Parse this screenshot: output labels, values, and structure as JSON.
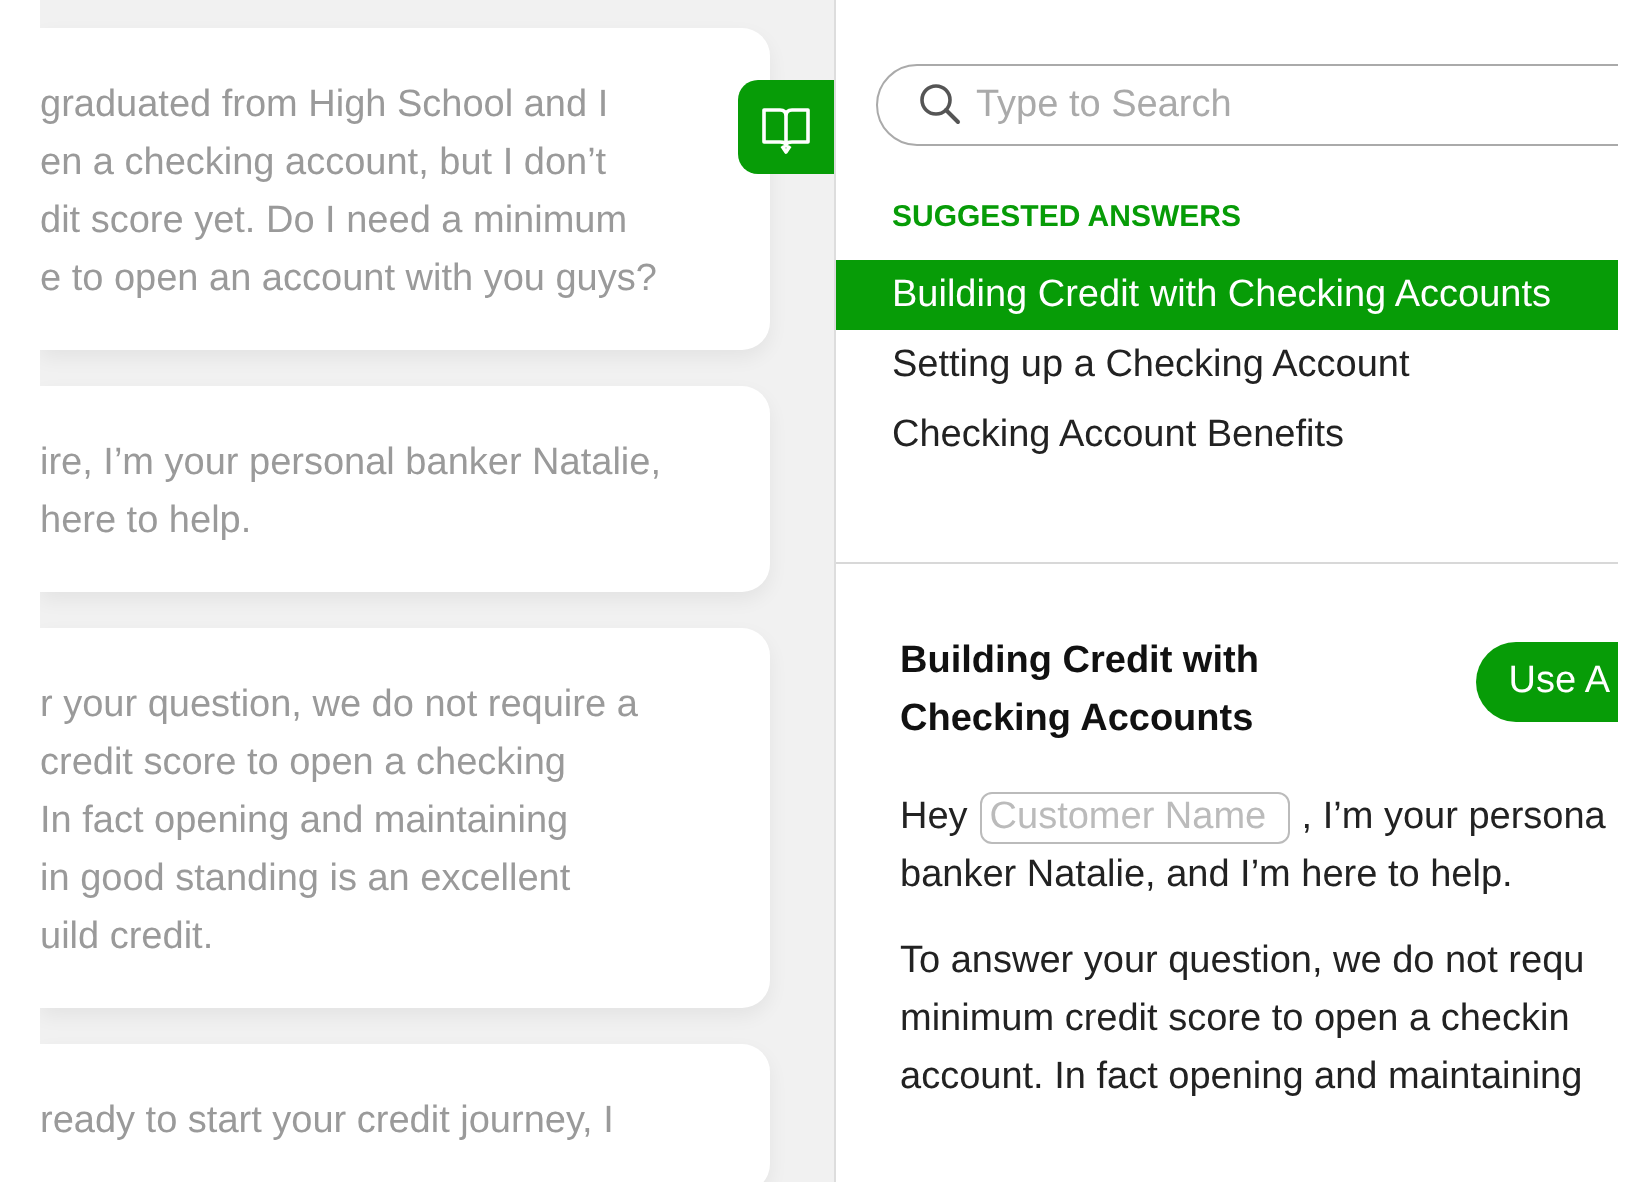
{
  "messages": [
    {
      "lines": [
        "graduated from High School and I",
        "en a checking account, but I don’t",
        "dit score yet. Do I need a minimum",
        "e to open an account with you guys?"
      ]
    },
    {
      "lines": [
        "ire, I’m your personal banker Natalie,",
        "here to help."
      ]
    },
    {
      "lines": [
        "r your question, we do not require a",
        "credit score to open a checking",
        "In fact opening and maintaining",
        "in good standing is an excellent",
        "uild credit."
      ]
    },
    {
      "lines": [
        "ready to start your credit journey, I"
      ]
    }
  ],
  "search": {
    "placeholder": "Type to Search"
  },
  "suggested": {
    "heading": "SUGGESTED ANSWERS",
    "items": [
      {
        "label": "Building Credit with Checking Accounts",
        "selected": true
      },
      {
        "label": "Setting up a Checking Account",
        "selected": false
      },
      {
        "label": "Checking Account Benefits",
        "selected": false
      }
    ]
  },
  "answer": {
    "title": "Building Credit with Checking Accounts",
    "use_button": "Use A",
    "greeting": {
      "before": "Hey",
      "field_placeholder": "Customer Name",
      "after": ", I’m your persona",
      "next_line": "banker Natalie, and I’m here to help."
    },
    "paragraph_lines": [
      "To answer your question, we do not requ",
      "minimum credit score to open a checkin",
      "account. In fact opening and maintaining"
    ]
  }
}
